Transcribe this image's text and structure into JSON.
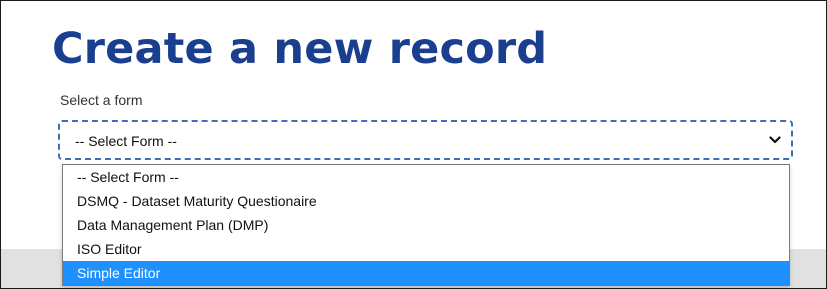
{
  "page": {
    "title": "Create a new record"
  },
  "form_select": {
    "label": "Select a form",
    "value": "-- Select Form --",
    "options": [
      {
        "label": "-- Select Form --",
        "highlighted": false
      },
      {
        "label": "DSMQ - Dataset Maturity Questionaire",
        "highlighted": false
      },
      {
        "label": "Data Management Plan (DMP)",
        "highlighted": false
      },
      {
        "label": "ISO Editor",
        "highlighted": false
      },
      {
        "label": "Simple Editor",
        "highlighted": true
      }
    ]
  },
  "icons": {
    "dropdown_toggle": "chevron-down-icon"
  },
  "colors": {
    "title": "#1b3f8f",
    "select_border": "#3c6fb5",
    "option_highlight": "#1e90ff",
    "bottom_band": "#e1e1e1"
  }
}
